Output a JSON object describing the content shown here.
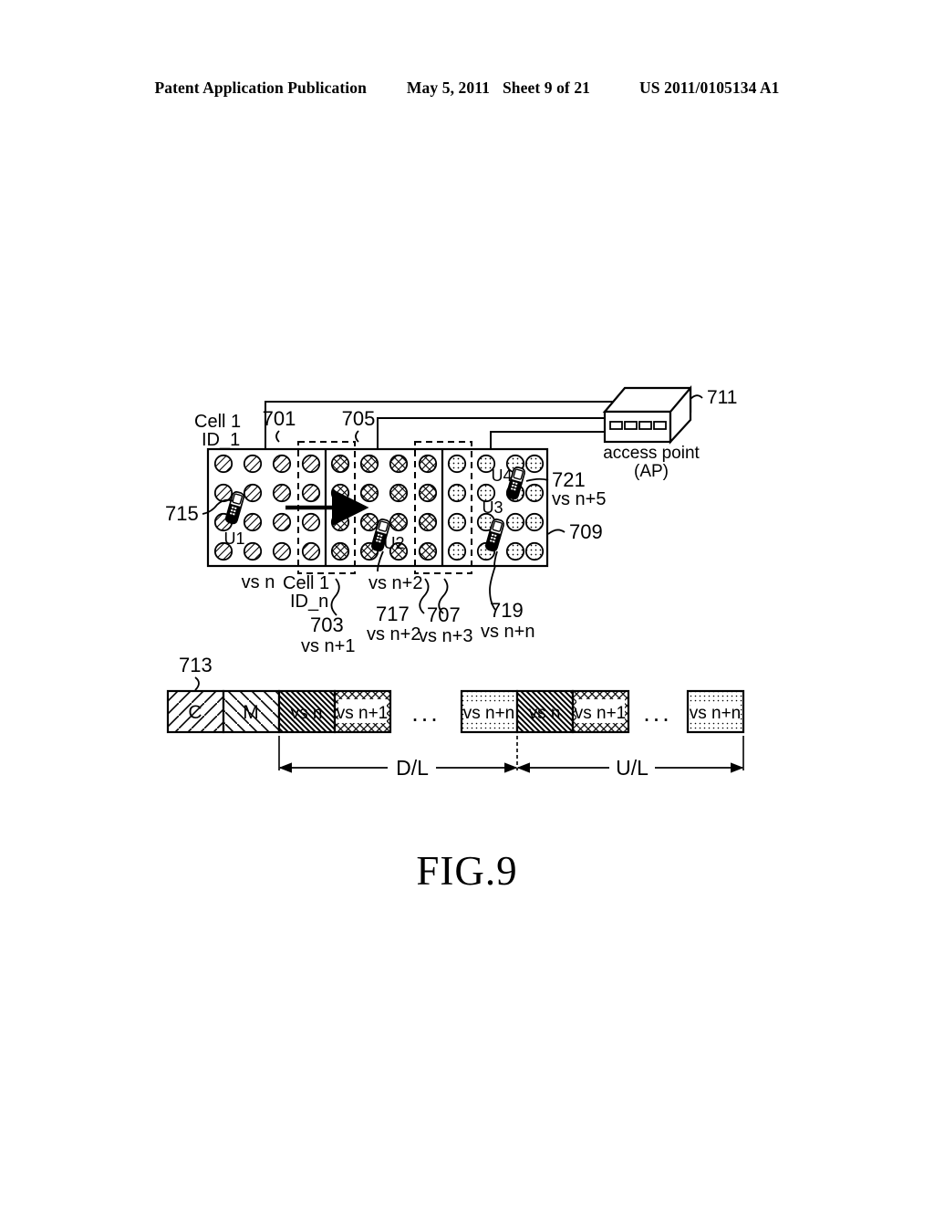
{
  "header": {
    "publication": "Patent Application Publication",
    "date": "May 5, 2011",
    "sheet": "Sheet 9 of 21",
    "patent_number": "US 2011/0105134 A1"
  },
  "figure": {
    "caption": "FIG.9",
    "cell_top_label_line1": "Cell 1",
    "cell_top_label_line2": "ID_1",
    "cell_bottom_label_line1": "Cell 1",
    "cell_bottom_label_line2": "ID_n",
    "access_point_line1": "access point",
    "access_point_line2": "(AP)"
  },
  "reference_numerals": {
    "n701": "701",
    "n703": "703",
    "n705": "705",
    "n707": "707",
    "n709": "709",
    "n711": "711",
    "n713": "713",
    "n715": "715",
    "n717": "717",
    "n719": "719",
    "n721": "721"
  },
  "vs_labels": {
    "vs_n": "vs n",
    "vs_n1": "vs n+1",
    "vs_n2": "vs n+2",
    "vs_n2b": "vs n+2",
    "vs_n3": "vs n+3",
    "vs_n5": "vs n+5",
    "vs_nn": "vs n+n"
  },
  "terminals": [
    {
      "id": "U1",
      "label": "U1"
    },
    {
      "id": "U2",
      "label": "U2"
    },
    {
      "id": "U3",
      "label": "U3"
    },
    {
      "id": "U4",
      "label": "U4"
    }
  ],
  "frame": {
    "blocks_group1": [
      {
        "label": "C",
        "pattern": "diag-left-sparse"
      },
      {
        "label": "M",
        "pattern": "diag-right-sparse"
      },
      {
        "label": "vs n",
        "pattern": "diag-right-dense"
      },
      {
        "label": "vs n+1",
        "pattern": "crosshatch"
      }
    ],
    "ellipsis1": "...",
    "blocks_group2": [
      {
        "label": "vs n+n",
        "pattern": "dotted"
      },
      {
        "label": "vs n",
        "pattern": "diag-right-dense"
      },
      {
        "label": "vs n+1",
        "pattern": "crosshatch"
      }
    ],
    "ellipsis2": "...",
    "blocks_group3": [
      {
        "label": "vs n+n",
        "pattern": "dotted"
      }
    ],
    "span_downlink": "D/L",
    "span_uplink": "U/L"
  },
  "colors": {
    "ink": "#000000",
    "paper": "#ffffff"
  }
}
